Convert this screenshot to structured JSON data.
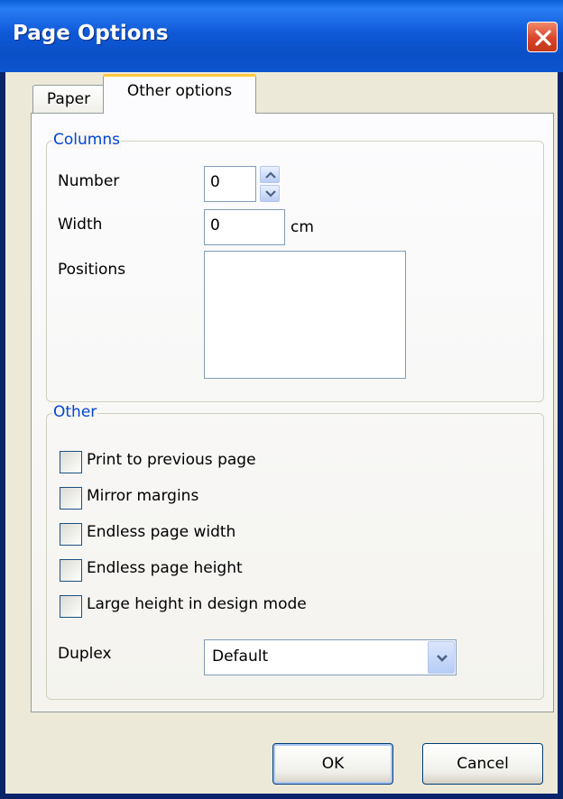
{
  "window": {
    "title": "Page Options"
  },
  "tabs": [
    {
      "label": "Paper",
      "selected": false
    },
    {
      "label": "Other options",
      "selected": true
    }
  ],
  "columns": {
    "group_label": "Columns",
    "number_label": "Number",
    "number_value": "0",
    "width_label": "Width",
    "width_value": "0",
    "width_unit": "cm",
    "positions_label": "Positions",
    "positions_value": ""
  },
  "other": {
    "group_label": "Other",
    "checkboxes": [
      {
        "label": "Print to previous page",
        "checked": false
      },
      {
        "label": "Mirror margins",
        "checked": false
      },
      {
        "label": "Endless page width",
        "checked": false
      },
      {
        "label": "Endless page height",
        "checked": false
      },
      {
        "label": "Large height in design mode",
        "checked": false
      }
    ],
    "duplex_label": "Duplex",
    "duplex_value": "Default"
  },
  "buttons": {
    "ok": "OK",
    "cancel": "Cancel"
  },
  "colors": {
    "titlebar": "#0a5fd6",
    "face": "#ece9d8",
    "group_label": "#0046d5",
    "close_button": "#d9452b"
  },
  "icons": {
    "close": "close-icon",
    "spin_up": "chevron-up-icon",
    "spin_down": "chevron-down-icon",
    "dropdown": "chevron-down-icon"
  }
}
